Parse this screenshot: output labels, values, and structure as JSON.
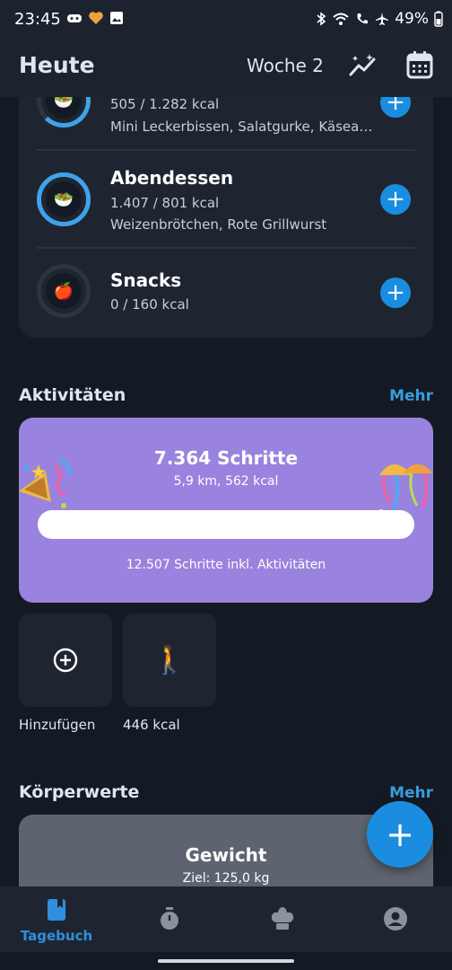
{
  "status": {
    "time": "23:45",
    "battery": "49%"
  },
  "appbar": {
    "title": "Heute",
    "week": "Woche 2"
  },
  "meals": [
    {
      "name": "",
      "kcal": "505 / 1.282 kcal",
      "items": "Mini Leckerbissen, Salatgurke, Käsea…",
      "emoji": "🥗"
    },
    {
      "name": "Abendessen",
      "kcal": "1.407 / 801 kcal",
      "items": "Weizenbrötchen, Rote Grillwurst",
      "emoji": "🥗"
    },
    {
      "name": "Snacks",
      "kcal": "0 / 160 kcal",
      "items": "",
      "emoji": "🍎"
    }
  ],
  "activities": {
    "title": "Aktivitäten",
    "more": "Mehr",
    "steps": "7.364 Schritte",
    "details": "5,9 km, 562 kcal",
    "footer": "12.507 Schritte inkl. Aktivitäten",
    "tiles": [
      {
        "label": "Hinzufügen"
      },
      {
        "label": "446 kcal",
        "emoji": "🚶"
      }
    ]
  },
  "body_values": {
    "title": "Körperwerte",
    "more": "Mehr",
    "weight_title": "Gewicht",
    "weight_goal": "Ziel: 125,0 kg"
  },
  "fab": {
    "label": "+"
  },
  "nav": {
    "diary": "Tagebuch"
  },
  "colors": {
    "accent": "#1a8de0",
    "steps_card": "#9a83de",
    "ring": "#3fa3e8"
  }
}
